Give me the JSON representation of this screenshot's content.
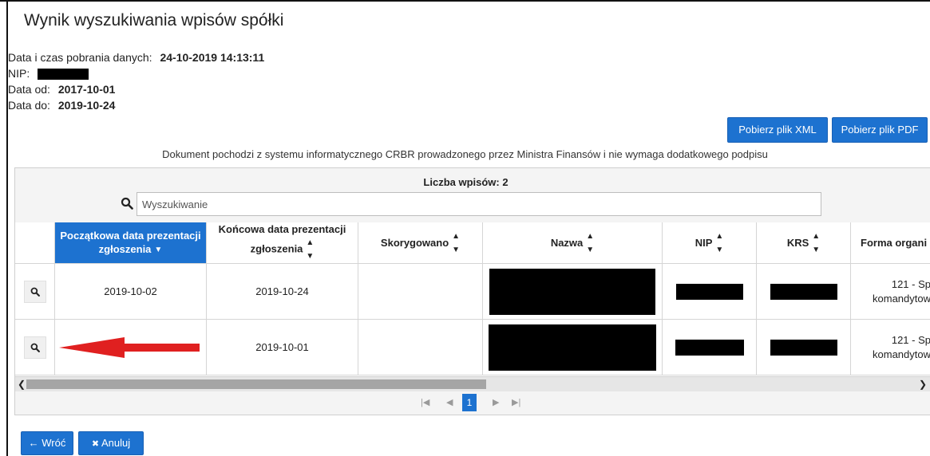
{
  "page": {
    "title": "Wynik wyszukiwania wpisów spółki",
    "meta": {
      "fetch_label": "Data i czas pobrania danych:",
      "fetch_value": "24-10-2019 14:13:11",
      "nip_label": "NIP:",
      "date_from_label": "Data od:",
      "date_from_value": "2017-10-01",
      "date_to_label": "Data do:",
      "date_to_value": "2019-10-24"
    },
    "buttons": {
      "xml": "Pobierz plik XML",
      "pdf": "Pobierz plik PDF"
    },
    "notice": "Dokument pochodzi z systemu informatycznego CRBR prowadzonego przez Ministra Finansów i nie wymaga dodatkowego podpisu"
  },
  "grid": {
    "count_label": "Liczba wpisów: 2",
    "search_placeholder": "Wyszukiwanie",
    "columns": [
      {
        "label": "Początkowa data prezentacji zgłoszenia",
        "sort": "desc",
        "active": true
      },
      {
        "label": "Końcowa data prezentacji zgłoszenia",
        "sort": "both"
      },
      {
        "label": "Skorygowano",
        "sort": "both"
      },
      {
        "label": "Nazwa",
        "sort": "both"
      },
      {
        "label": "NIP",
        "sort": "both"
      },
      {
        "label": "KRS",
        "sort": "both"
      },
      {
        "label": "Forma organi",
        "sort": "none"
      }
    ],
    "rows": [
      {
        "start": "2019-10-02",
        "end": "2019-10-24",
        "corrected": "",
        "form_line1": "121 - Sp",
        "form_line2": "komandytow"
      },
      {
        "start": "",
        "end": "2019-10-01",
        "corrected": "",
        "form_line1": "121 - Sp",
        "form_line2": "komandytow"
      }
    ],
    "pager": {
      "current_page": "1"
    }
  },
  "footer": {
    "back": "Wróć",
    "cancel": "Anuluj"
  },
  "colors": {
    "accent": "#1d72d0",
    "annotation_arrow": "#e02020",
    "redaction": "#000000"
  }
}
